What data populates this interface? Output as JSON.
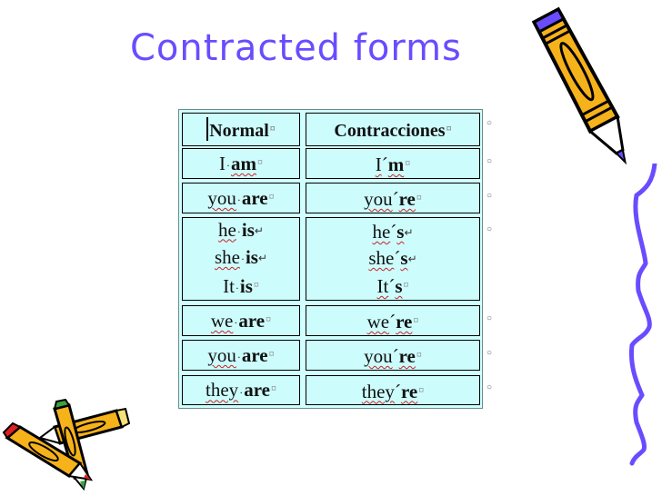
{
  "slide": {
    "title": "Contracted forms",
    "accent_color": "#6a4cff",
    "table_bg": "#cdfcfd"
  },
  "table": {
    "headers": {
      "normal": "Normal",
      "contracted": "Contracciones"
    },
    "rows": [
      {
        "normal": [
          {
            "pron": "I",
            "verb": "am"
          }
        ],
        "contracted": [
          {
            "pron": "I",
            "verb": "m"
          }
        ]
      },
      {
        "normal": [
          {
            "pron": "you",
            "verb": "are"
          }
        ],
        "contracted": [
          {
            "pron": "you",
            "verb": "re"
          }
        ]
      },
      {
        "normal": [
          {
            "pron": "he",
            "verb": "is"
          },
          {
            "pron": "she",
            "verb": "is"
          },
          {
            "pron": "It",
            "verb": "is"
          }
        ],
        "contracted": [
          {
            "pron": "he",
            "verb": "s"
          },
          {
            "pron": "she",
            "verb": "s"
          },
          {
            "pron": "It",
            "verb": "s"
          }
        ]
      },
      {
        "normal": [
          {
            "pron": "we",
            "verb": "are"
          }
        ],
        "contracted": [
          {
            "pron": "we",
            "verb": "re"
          }
        ]
      },
      {
        "normal": [
          {
            "pron": "you",
            "verb": "are"
          }
        ],
        "contracted": [
          {
            "pron": "you",
            "verb": "re"
          }
        ]
      },
      {
        "normal": [
          {
            "pron": "they",
            "verb": "are"
          }
        ],
        "contracted": [
          {
            "pron": "they",
            "verb": "re"
          }
        ]
      }
    ],
    "symbols": {
      "space_dot": "·",
      "apostrophe": "´",
      "cell_end": "¤",
      "line_break": "↵",
      "row_end": "○"
    }
  },
  "decorations": {
    "top_right": "pencil-clipart",
    "bottom_left": "crossed-pencils-clipart",
    "right_edge": "squiggle-line"
  }
}
